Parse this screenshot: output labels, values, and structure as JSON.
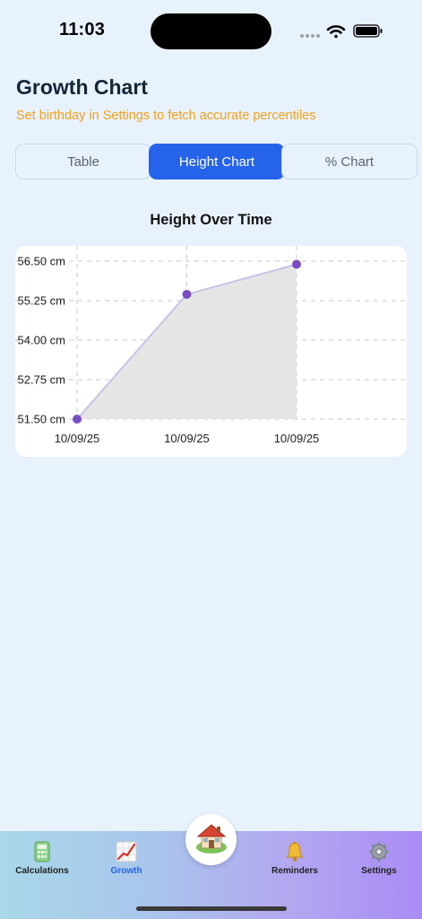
{
  "status_bar": {
    "time": "11:03",
    "icons": [
      "signal-dots-icon",
      "wifi-icon",
      "battery-icon"
    ]
  },
  "header": {
    "title": "Growth Chart",
    "subtitle": "Set birthday in Settings to fetch accurate percentiles"
  },
  "segments": [
    {
      "label": "Table",
      "active": false
    },
    {
      "label": "Height Chart",
      "active": true
    },
    {
      "label": "% Chart",
      "active": false
    }
  ],
  "colors": {
    "accent": "#2563eb",
    "warning": "#f2a01c",
    "point": "#7a4cc4",
    "line": "#c9c2e6",
    "area": "#e5e5e5"
  },
  "chart_data": {
    "type": "area",
    "title": "Height Over Time",
    "xlabel": "",
    "ylabel": "",
    "x": [
      "10/09/25",
      "10/09/25",
      "10/09/25"
    ],
    "series": [
      {
        "values": [
          51.5,
          55.45,
          56.4
        ]
      }
    ],
    "y_ticks": [
      "51.50 cm",
      "52.75 cm",
      "54.00 cm",
      "55.25 cm",
      "56.50 cm"
    ],
    "ylim": [
      51.5,
      56.5
    ],
    "grid": true,
    "legend": "none"
  },
  "tabbar": {
    "items": [
      {
        "label": "Calculations",
        "icon": "calculator-icon",
        "active": false
      },
      {
        "label": "Growth",
        "icon": "chart-increasing-icon",
        "active": true
      },
      {
        "label": "Reminders",
        "icon": "bell-icon",
        "active": false
      },
      {
        "label": "Settings",
        "icon": "gear-icon",
        "active": false
      }
    ],
    "center_icon": "house-icon"
  }
}
